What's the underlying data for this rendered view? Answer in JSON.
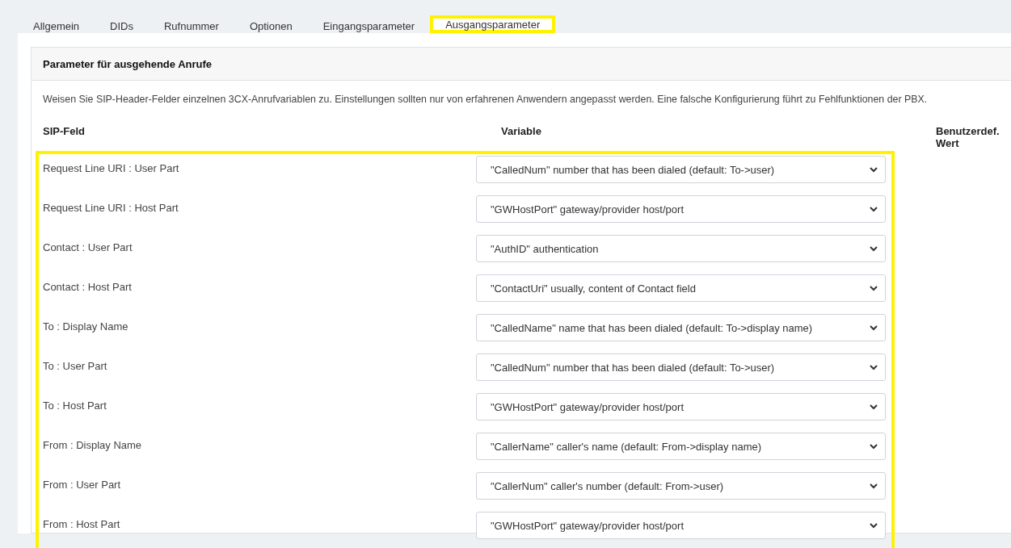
{
  "tabs": [
    {
      "label": "Allgemein",
      "selected": false
    },
    {
      "label": "DIDs",
      "selected": false
    },
    {
      "label": "Rufnummer",
      "selected": false
    },
    {
      "label": "Optionen",
      "selected": false
    },
    {
      "label": "Eingangsparameter",
      "selected": false
    },
    {
      "label": "Ausgangsparameter",
      "selected": true
    }
  ],
  "section": {
    "title": "Parameter für ausgehende Anrufe",
    "description": "Weisen Sie SIP-Header-Felder einzelnen 3CX-Anrufvariablen zu. Einstellungen sollten nur von erfahrenen Anwendern angepasst werden. Eine falsche Konfigurierung führt zu Fehlfunktionen der PBX.",
    "columns": [
      "SIP-Feld",
      "Variable",
      "Benutzerdef. Wert"
    ],
    "rows": [
      {
        "field": "Request Line URI : User Part",
        "variable": "\"CalledNum\" number that has been dialed (default: To->user)"
      },
      {
        "field": "Request Line URI : Host Part",
        "variable": "\"GWHostPort\" gateway/provider host/port"
      },
      {
        "field": "Contact : User Part",
        "variable": "\"AuthID\" authentication"
      },
      {
        "field": "Contact : Host Part",
        "variable": "\"ContactUri\" usually, content of Contact field"
      },
      {
        "field": "To : Display Name",
        "variable": "\"CalledName\" name that has been dialed (default: To->display name)"
      },
      {
        "field": "To : User Part",
        "variable": "\"CalledNum\" number that has been dialed (default: To->user)"
      },
      {
        "field": "To : Host Part",
        "variable": "\"GWHostPort\" gateway/provider host/port"
      },
      {
        "field": "From : Display Name",
        "variable": "\"CallerName\" caller's name (default: From->display name)"
      },
      {
        "field": "From : User Part",
        "variable": "\"CallerNum\" caller's number (default: From->user)"
      },
      {
        "field": "From : Host Part",
        "variable": "\"GWHostPort\" gateway/provider host/port"
      }
    ]
  }
}
